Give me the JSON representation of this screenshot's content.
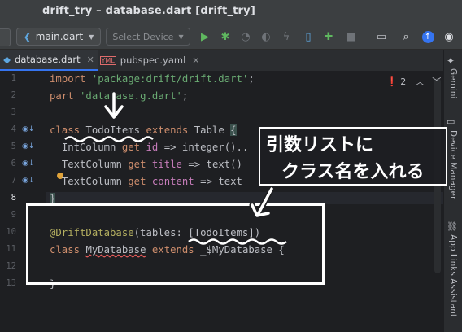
{
  "window": {
    "title": "drift_try – database.dart [drift_try]"
  },
  "toolbar": {
    "run_config": "main.dart",
    "device": "Select Device",
    "icons": [
      "run-icon",
      "debug-icon",
      "profile-icon",
      "coverage-icon",
      "hot-reload-icon",
      "attach-icon",
      "flutter-inspector-icon",
      "stop-icon",
      "device-manager-icon",
      "search-icon",
      "update-icon",
      "account-icon"
    ]
  },
  "tabs": [
    {
      "label": "database.dart",
      "active": true
    },
    {
      "label": "pubspec.yaml",
      "active": false
    }
  ],
  "right_tools": [
    "Gemini",
    "Device Manager",
    "App Links Assistant"
  ],
  "editor": {
    "problems_count": "2",
    "line_numbers": [
      "1",
      "2",
      "3",
      "4",
      "5",
      "6",
      "7",
      "8",
      "9",
      "10",
      "11",
      "12",
      "13"
    ],
    "current_line": "8"
  },
  "code": {
    "l1_kw": "import",
    "l1_str": "'package:drift/drift.dart'",
    "l1_end": ";",
    "l2_kw": "part",
    "l2_str": "'database.g.dart'",
    "l2_end": ";",
    "l4_kw1": "class",
    "l4_name": "TodoItems",
    "l4_kw2": "extends",
    "l4_base": "Table",
    "l4_brace": "{",
    "l5_type": "IntColumn",
    "l5_get": "get",
    "l5_prop": "id",
    "l5_rest": "=> integer()..",
    "l6_type": "TextColumn",
    "l6_get": "get",
    "l6_prop": "title",
    "l6_rest": "=> text()",
    "l7_type": "TextColumn",
    "l7_get": "get",
    "l7_prop": "content",
    "l7_rest": "=> text",
    "l8": "}",
    "l10_ann": "@DriftDatabase",
    "l10_args": "(tables: [TodoItems])",
    "l11_kw1": "class",
    "l11_name": "MyDatabase",
    "l11_kw2": "extends",
    "l11_base": "_$MyDatabase {",
    "l13": "}"
  },
  "callout": {
    "line1": "引数リストに",
    "line2": "クラス名を入れる"
  },
  "colors": {
    "accent": "#3574f0",
    "keyword": "#cf8e6d",
    "string": "#6aab73",
    "annotation": "#b3ae60",
    "property": "#c77dbb",
    "run_green": "#5fb85f",
    "error_red": "#e55b5b"
  }
}
